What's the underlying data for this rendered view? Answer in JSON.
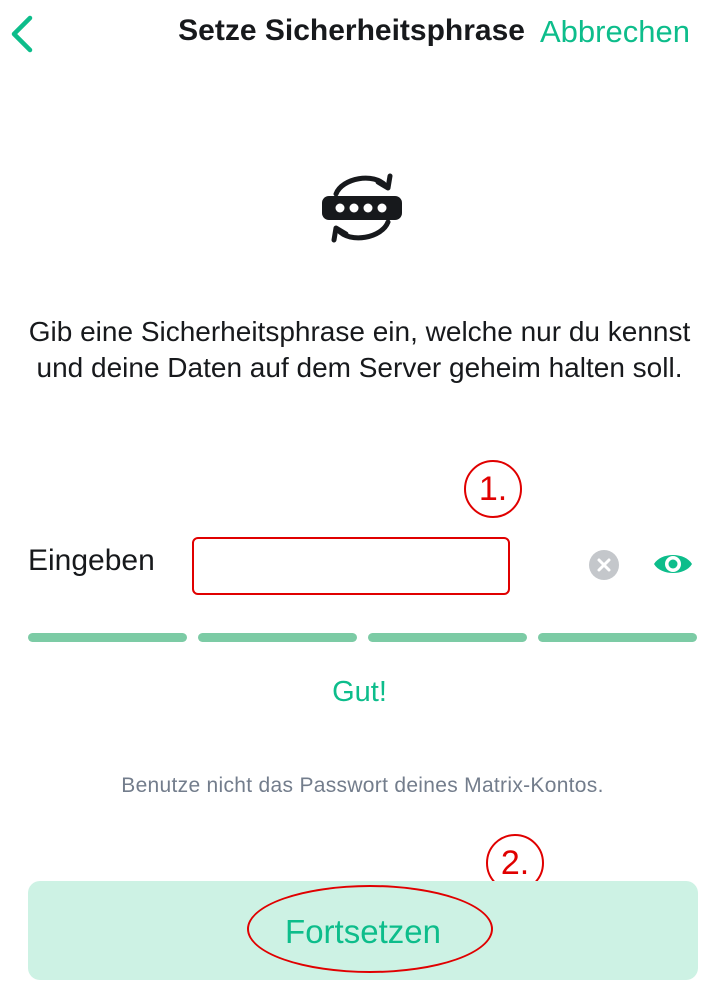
{
  "header": {
    "title": "Setze Sicherheitsphrase",
    "cancel_label": "Abbrechen"
  },
  "icons": {
    "back": "chevron-left-icon",
    "key": "key-backup-icon",
    "clear": "clear-icon",
    "reveal": "eye-icon"
  },
  "description": "Gib eine Sicherheitsphrase ein, welche nur du kennst und deine Daten auf dem Server geheim halten soll.",
  "annotations": {
    "step1": "1.",
    "step2": "2."
  },
  "passphrase": {
    "label": "Eingeben",
    "value": "",
    "placeholder": ""
  },
  "strength": {
    "level": 4,
    "max": 4,
    "label": "Gut!"
  },
  "hint": "Benutze nicht das Passwort deines Matrix-Kontos.",
  "continue_label": "Fortsetzen",
  "colors": {
    "accent": "#0dbd8b",
    "strength_bar": "#7ccba5",
    "button_bg": "#cdf2e4",
    "annotation": "#e00000"
  }
}
